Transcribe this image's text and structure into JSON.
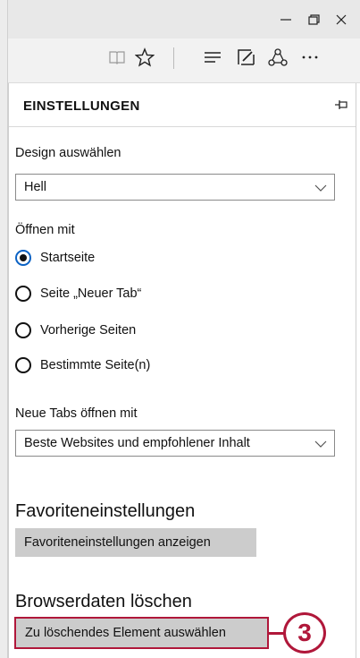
{
  "window": {
    "minimize_icon": "minimize-icon",
    "restore_icon": "restore-icon",
    "close_icon": "close-icon"
  },
  "toolbar": {
    "icons": [
      "reading-view-icon",
      "favorites-star-icon",
      "hub-icon",
      "web-note-icon",
      "share-icon",
      "more-icon"
    ]
  },
  "settings": {
    "title": "EINSTELLUNGEN",
    "design": {
      "label": "Design auswählen",
      "value": "Hell"
    },
    "open_with": {
      "label": "Öffnen mit",
      "options": [
        "Startseite",
        "Seite „Neuer Tab“",
        "Vorherige Seiten",
        "Bestimmte Seite(n)"
      ],
      "selected": 0
    },
    "new_tabs": {
      "label": "Neue Tabs öffnen mit",
      "value": "Beste Websites und empfohlener Inhalt"
    },
    "favorites": {
      "title": "Favoriteneinstellungen",
      "button": "Favoriteneinstellungen anzeigen"
    },
    "clear": {
      "title": "Browserdaten löschen",
      "button": "Zu löschendes Element auswählen"
    }
  },
  "callout": {
    "number": "3",
    "color": "#b0173a"
  },
  "colors": {
    "accent": "#0b62c4",
    "button_gray": "#cccccc"
  }
}
